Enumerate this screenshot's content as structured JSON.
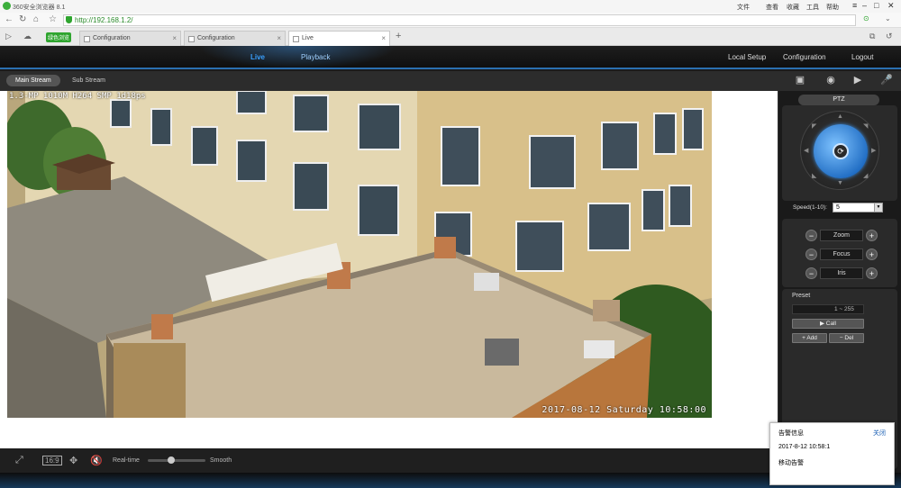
{
  "browser": {
    "app_title": "360安全浏览器 8.1",
    "menu": [
      "文件",
      "查看",
      "收藏",
      "工具",
      "帮助"
    ],
    "url": "http://192.168.1.2/",
    "green_badge": "绿色浏览",
    "tabs": [
      {
        "label": "Configuration"
      },
      {
        "label": "Configuration"
      },
      {
        "label": "Live"
      }
    ]
  },
  "app": {
    "nav": {
      "live": "Live",
      "playback": "Playback",
      "local_setup": "Local Setup",
      "configuration": "Configuration",
      "logout": "Logout"
    },
    "streams": {
      "main": "Main Stream",
      "sub": "Sub Stream"
    },
    "video": {
      "osd_top": "1.3-MP 1010M H264 SMP 1d18ps",
      "osd_timestamp": "2017-08-12 Saturday 10:58:00"
    },
    "bottom": {
      "realtime_label": "Real-time",
      "smooth_label": "Smooth",
      "slider_value": 0.4
    },
    "ptz": {
      "title": "PTZ",
      "speed_label": "Speed(1-10):",
      "speed_value": "5",
      "zoom": "Zoom",
      "focus": "Focus",
      "iris": "Iris",
      "preset_label": "Preset",
      "preset_range": "1 ~ 255",
      "call": "Call",
      "add": "Add",
      "del": "Del"
    }
  },
  "alarm": {
    "title": "告警信息",
    "close": "关闭",
    "datetime": "2017-8-12 10:58:1",
    "message": "移动告警"
  },
  "colors": {
    "accent": "#39a0ff",
    "panel": "#2a2a2a"
  }
}
